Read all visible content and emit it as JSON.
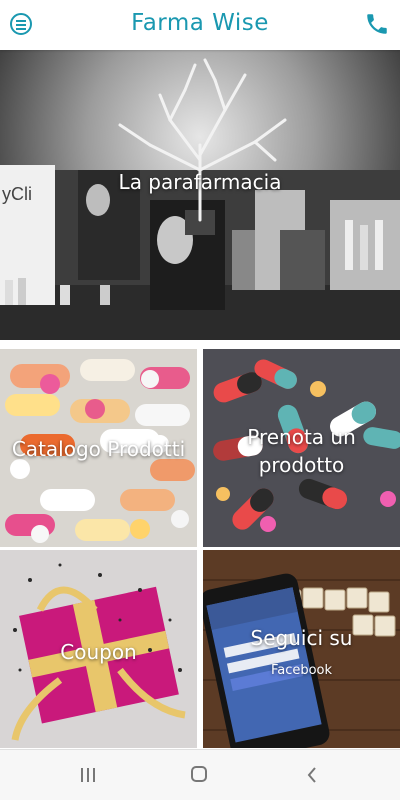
{
  "header": {
    "title": "Farma Wise"
  },
  "tiles": {
    "hero": "La parafarmacia",
    "catalogo": "Catalogo Prodotti",
    "prenota_line1": "Prenota un",
    "prenota_line2": "prodotto",
    "coupon": "Coupon",
    "seguici": "Seguici su",
    "facebook": "Facebook"
  },
  "colors": {
    "accent": "#1a98b0"
  },
  "icons": {
    "menu": "menu-icon",
    "phone": "phone-icon",
    "nav_recent": "recent-apps-icon",
    "nav_home": "home-icon",
    "nav_back": "back-icon"
  }
}
